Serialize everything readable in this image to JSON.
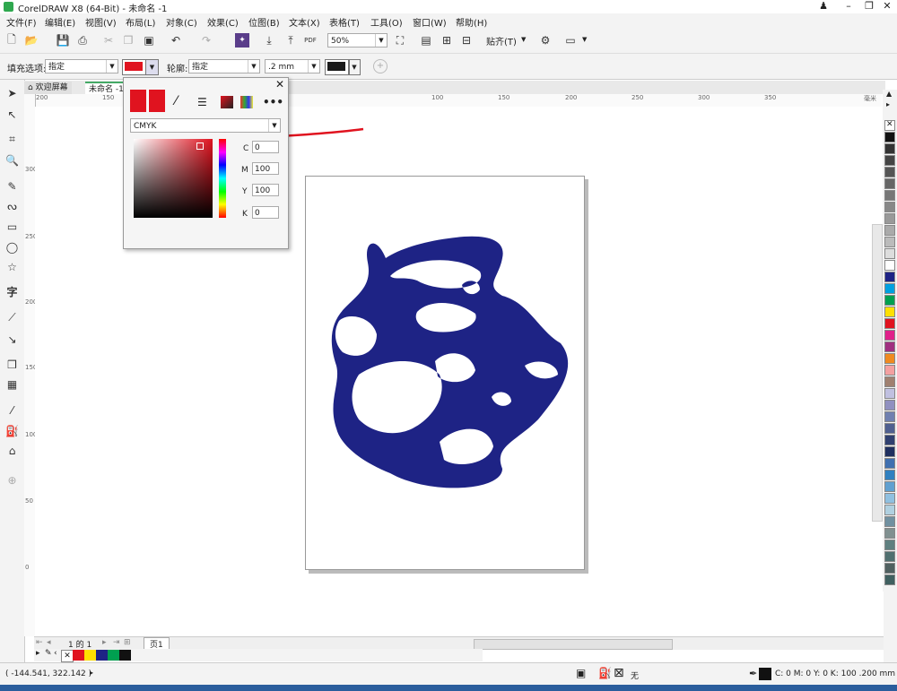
{
  "window": {
    "title": "CorelDRAW X8 (64-Bit) - 未命名 -1"
  },
  "menu": [
    "文件(F)",
    "编辑(E)",
    "视图(V)",
    "布局(L)",
    "对象(C)",
    "效果(C)",
    "位图(B)",
    "文本(X)",
    "表格(T)",
    "工具(O)",
    "窗口(W)",
    "帮助(H)"
  ],
  "toolbar": {
    "zoom": "50%",
    "snap": "贴齐(T)",
    "pdf": "PDF"
  },
  "propbar": {
    "fill_label": "填充选项:",
    "fill_value": "指定",
    "outline_label": "轮廓:",
    "outline_value": "指定",
    "outline_width": ".2 mm"
  },
  "tabs": {
    "welcome": "欢迎屏幕",
    "doc": "未命名 -1"
  },
  "ruler": {
    "h_ticks": [
      "200",
      "150",
      "100",
      "150",
      "200",
      "250",
      "300",
      "350"
    ],
    "h_unit": "毫米",
    "v_ticks": [
      "300",
      "250",
      "200",
      "150",
      "100",
      "50",
      "0"
    ]
  },
  "picker": {
    "model": "CMYK",
    "c_label": "C",
    "m_label": "M",
    "y_label": "Y",
    "k_label": "K",
    "c": "0",
    "m": "100",
    "y": "100",
    "k": "0",
    "color": "#e0131f"
  },
  "pagenav": {
    "pages": "1 的 1",
    "tab": "页1"
  },
  "status": {
    "coords": "( -144.541, 322.142 )",
    "none": "无",
    "color_info": "C: 0 M: 0 Y: 0 K: 100  .200 mm"
  },
  "colors": {
    "accent": "#e0131f",
    "shape": "#1e2385"
  }
}
